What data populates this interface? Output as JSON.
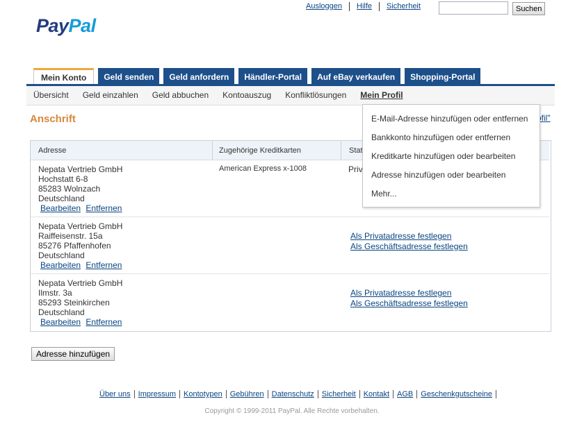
{
  "header": {
    "logo_pay": "Pay",
    "logo_pal": "Pal",
    "links": [
      "Ausloggen",
      "Hilfe",
      "Sicherheit"
    ],
    "search_button": "Suchen"
  },
  "tabs": [
    "Mein Konto",
    "Geld senden",
    "Geld anfordern",
    "Händler-Portal",
    "Auf eBay verkaufen",
    "Shopping-Portal"
  ],
  "subnav": [
    "Übersicht",
    "Geld einzahlen",
    "Geld abbuchen",
    "Kontoauszug",
    "Konfliktlösungen",
    "Mein Profil"
  ],
  "page": {
    "title": "Anschrift",
    "profil_link_fragment": "ofil\""
  },
  "table": {
    "headers": [
      "Adresse",
      "Zugehörige Kreditkarten",
      "Stat"
    ],
    "rows": [
      {
        "lines": [
          "Nepata Vertrieb GmbH",
          "Hochstatt 6-8",
          "85283 Wolnzach",
          "Deutschland"
        ],
        "card": "American Express  x-1008",
        "status": "Priv",
        "edit": "Bearbeiten",
        "remove": "Entfernen"
      },
      {
        "lines": [
          "Nepata Vertrieb GmbH",
          "Raiffeisenstr. 15a",
          "85276 Pfaffenhofen",
          "Deutschland"
        ],
        "set_private": "Als Privatadresse festlegen",
        "set_business": "Als Geschäftsadresse festlegen",
        "edit": "Bearbeiten",
        "remove": "Entfernen"
      },
      {
        "lines": [
          "Nepata Vertrieb GmbH",
          "Ilmstr. 3a",
          "85293 Steinkirchen",
          "Deutschland"
        ],
        "set_private": "Als Privatadresse festlegen",
        "set_business": "Als Geschäftsadresse festlegen",
        "edit": "Bearbeiten",
        "remove": "Entfernen"
      }
    ]
  },
  "add_button": "Adresse hinzufügen",
  "dropdown": [
    "E-Mail-Adresse hinzufügen oder entfernen",
    "Bankkonto hinzufügen oder entfernen",
    "Kreditkarte hinzufügen oder bearbeiten",
    "Adresse hinzufügen oder bearbeiten",
    "Mehr..."
  ],
  "footer": {
    "links": [
      "Über uns",
      "Impressum",
      "Kontotypen",
      "Gebühren",
      "Datenschutz",
      "Sicherheit",
      "Kontakt",
      "AGB",
      "Geschenkgutscheine"
    ],
    "copyright": "Copyright © 1999-2011 PayPal. Alle Rechte vorbehalten."
  }
}
